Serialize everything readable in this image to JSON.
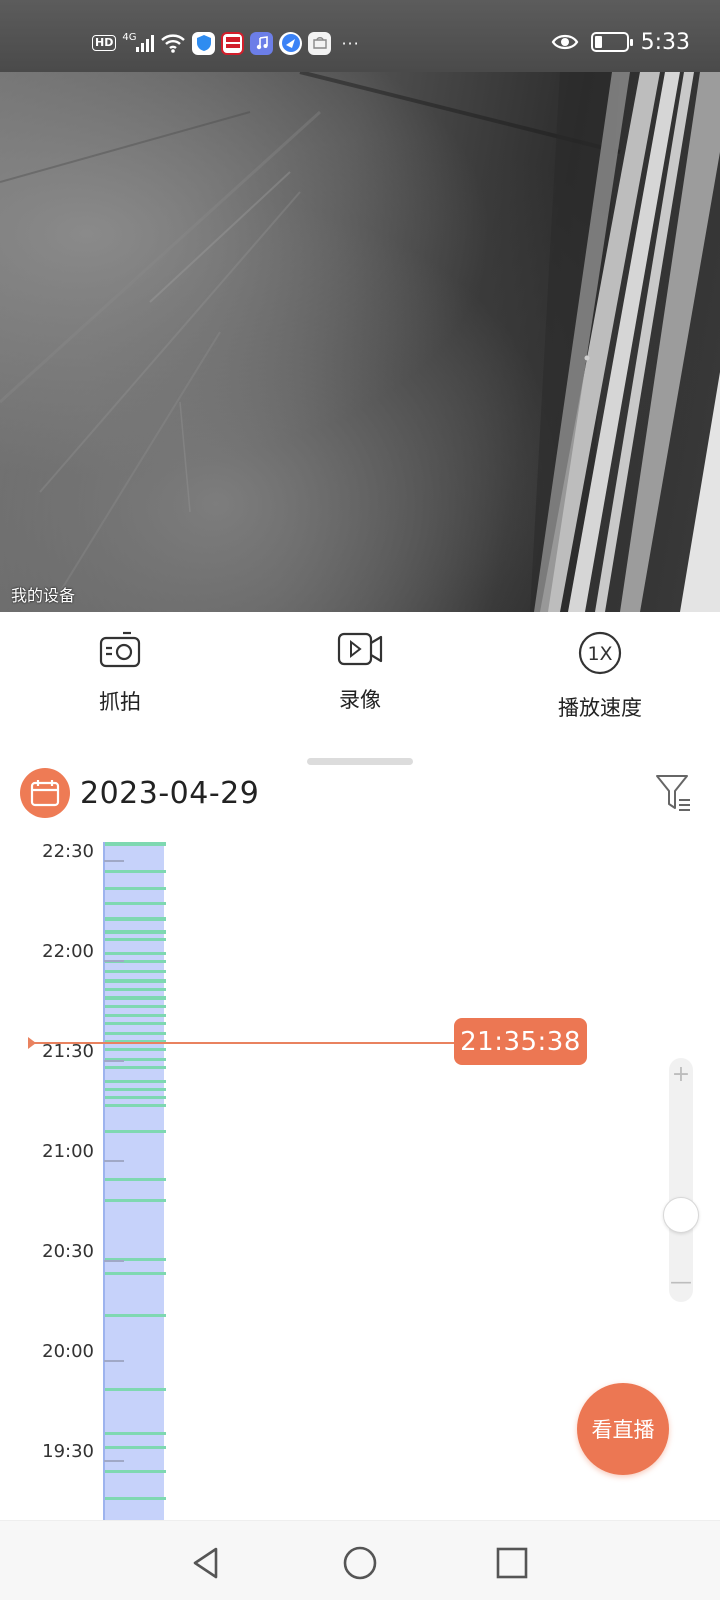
{
  "status_bar": {
    "network": "4G",
    "hd": "HD",
    "more_indicator": "···",
    "time": "5:33",
    "icons": [
      "hd-icon",
      "signal-icon",
      "wifi-icon",
      "shield-app-icon",
      "news-app-icon",
      "music-app-icon",
      "browser-app-icon",
      "store-app-icon",
      "eye-icon",
      "battery-icon"
    ]
  },
  "video": {
    "label": "我的设备"
  },
  "controls": {
    "snapshot_label": "抓拍",
    "record_label": "录像",
    "speed_label": "播放速度",
    "speed_value": "1X"
  },
  "date": {
    "value": "2023-04-29"
  },
  "timeline": {
    "labels": [
      "22:30",
      "22:00",
      "21:30",
      "21:00",
      "20:30",
      "20:00",
      "19:30"
    ],
    "current_time": "21:35:38"
  },
  "live_button": {
    "label": "看直播"
  },
  "colors": {
    "accent": "#ec7753",
    "track": "#c6d2fa",
    "recording": "#7ed8b1"
  }
}
